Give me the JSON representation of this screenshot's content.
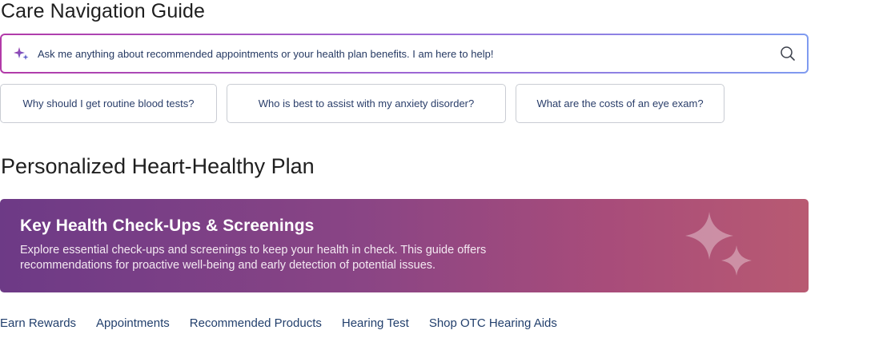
{
  "care_guide": {
    "title": "Care Navigation Guide",
    "search": {
      "placeholder": "Ask me anything about recommended appointments or your health plan benefits. I am here to help!",
      "value": ""
    },
    "suggestions": [
      {
        "label": "Why should I get routine blood tests?"
      },
      {
        "label": "Who is best to assist with my anxiety disorder?"
      },
      {
        "label": "What are the costs of an eye exam?"
      }
    ]
  },
  "plan": {
    "title": "Personalized Heart-Healthy Plan",
    "banner": {
      "title": "Key Health Check-Ups & Screenings",
      "description": "Explore essential check-ups and screenings to keep your health in check. This guide offers recommendations for proactive well-being and early detection of potential issues."
    }
  },
  "nav": {
    "links": [
      {
        "label": "Earn Rewards"
      },
      {
        "label": "Appointments"
      },
      {
        "label": "Recommended Products"
      },
      {
        "label": "Hearing Test"
      },
      {
        "label": "Shop OTC Hearing Aids"
      }
    ]
  },
  "icons": {
    "input_sparkle": "sparkle-icon",
    "search": "search-icon",
    "banner_sparkle": "sparkle-icon"
  },
  "colors": {
    "link": "#23406d",
    "banner_start": "#6d3a86",
    "banner_end": "#b85a72",
    "search_border_start": "#b23aa8",
    "search_border_end": "#7f9bf0"
  }
}
